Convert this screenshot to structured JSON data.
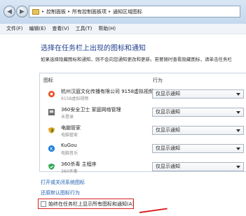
{
  "breadcrumb": {
    "items": [
      "控制面板",
      "所有控制面板项",
      "通知区域图标"
    ]
  },
  "menu": {
    "items": [
      "文件(F)",
      "编辑(E)",
      "查看(V)",
      "工具(T)",
      "帮助(H)"
    ]
  },
  "page": {
    "heading": "选择在任务栏上出现的图标和通知",
    "description": "如果选择隐藏图标和通知，则不会向您通知更改和更新。若要随时查看隐藏图标，请单击任务栏"
  },
  "table": {
    "col_icon": "图标",
    "col_behavior": "行为",
    "rows": [
      {
        "name": "杭州汉庭文化传播有限公司 9158虚拟视频 V5.2",
        "sub": "9158虚拟视频",
        "behavior": "仅显示通知",
        "icon": "camera-icon",
        "color": "#e8552a"
      },
      {
        "name": "360安全卫士 家庭网络管理",
        "sub": "未登录",
        "behavior": "仅显示通知",
        "icon": "network-icon",
        "color": "#6a6a6a"
      },
      {
        "name": "电脑管家",
        "sub": "电脑管家",
        "behavior": "仅显示通知",
        "icon": "shield-icon",
        "color": "#f0a020"
      },
      {
        "name": "KuGou",
        "sub": "电脑音乐",
        "behavior": "仅显示通知",
        "icon": "music-icon",
        "color": "#1e7fd8"
      },
      {
        "name": "360杀毒 主程序",
        "sub": "360杀毒",
        "behavior": "仅显示通知",
        "icon": "antivirus-icon",
        "color": "#2fa84f"
      }
    ]
  },
  "links": {
    "system_icons": "打开或关闭系统图标",
    "restore": "还原默认图标行为"
  },
  "checkbox": {
    "label": "始终在任务栏上显示所有图标和通知(A)"
  }
}
